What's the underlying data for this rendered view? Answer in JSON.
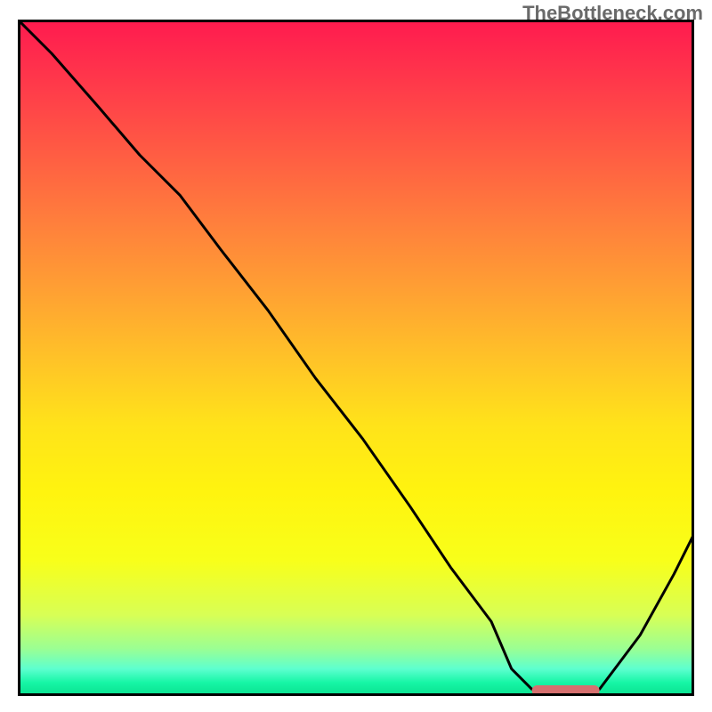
{
  "attribution": "TheBottleneck.com",
  "chart_data": {
    "type": "line",
    "title": "",
    "xlabel": "",
    "ylabel": "",
    "xlim": [
      0,
      100
    ],
    "ylim": [
      0,
      100
    ],
    "series": [
      {
        "name": "bottleneck-curve",
        "x": [
          0,
          5,
          12,
          18,
          24,
          30,
          37,
          44,
          51,
          58,
          64,
          70,
          73,
          76,
          82,
          86,
          92,
          97,
          100
        ],
        "values": [
          100,
          95,
          87,
          80,
          74,
          66,
          57,
          47,
          38,
          28,
          19,
          11,
          4,
          1,
          0.5,
          1,
          9,
          18,
          24
        ]
      }
    ],
    "marker": {
      "name": "optimal-range",
      "x_start": 76,
      "x_end": 86,
      "color": "#d6706f"
    },
    "background_gradient": {
      "stops": [
        {
          "pos": 0,
          "color": "#ff1a4f"
        },
        {
          "pos": 50,
          "color": "#ffc228"
        },
        {
          "pos": 80,
          "color": "#f8ff1a"
        },
        {
          "pos": 100,
          "color": "#08e08e"
        }
      ]
    }
  }
}
